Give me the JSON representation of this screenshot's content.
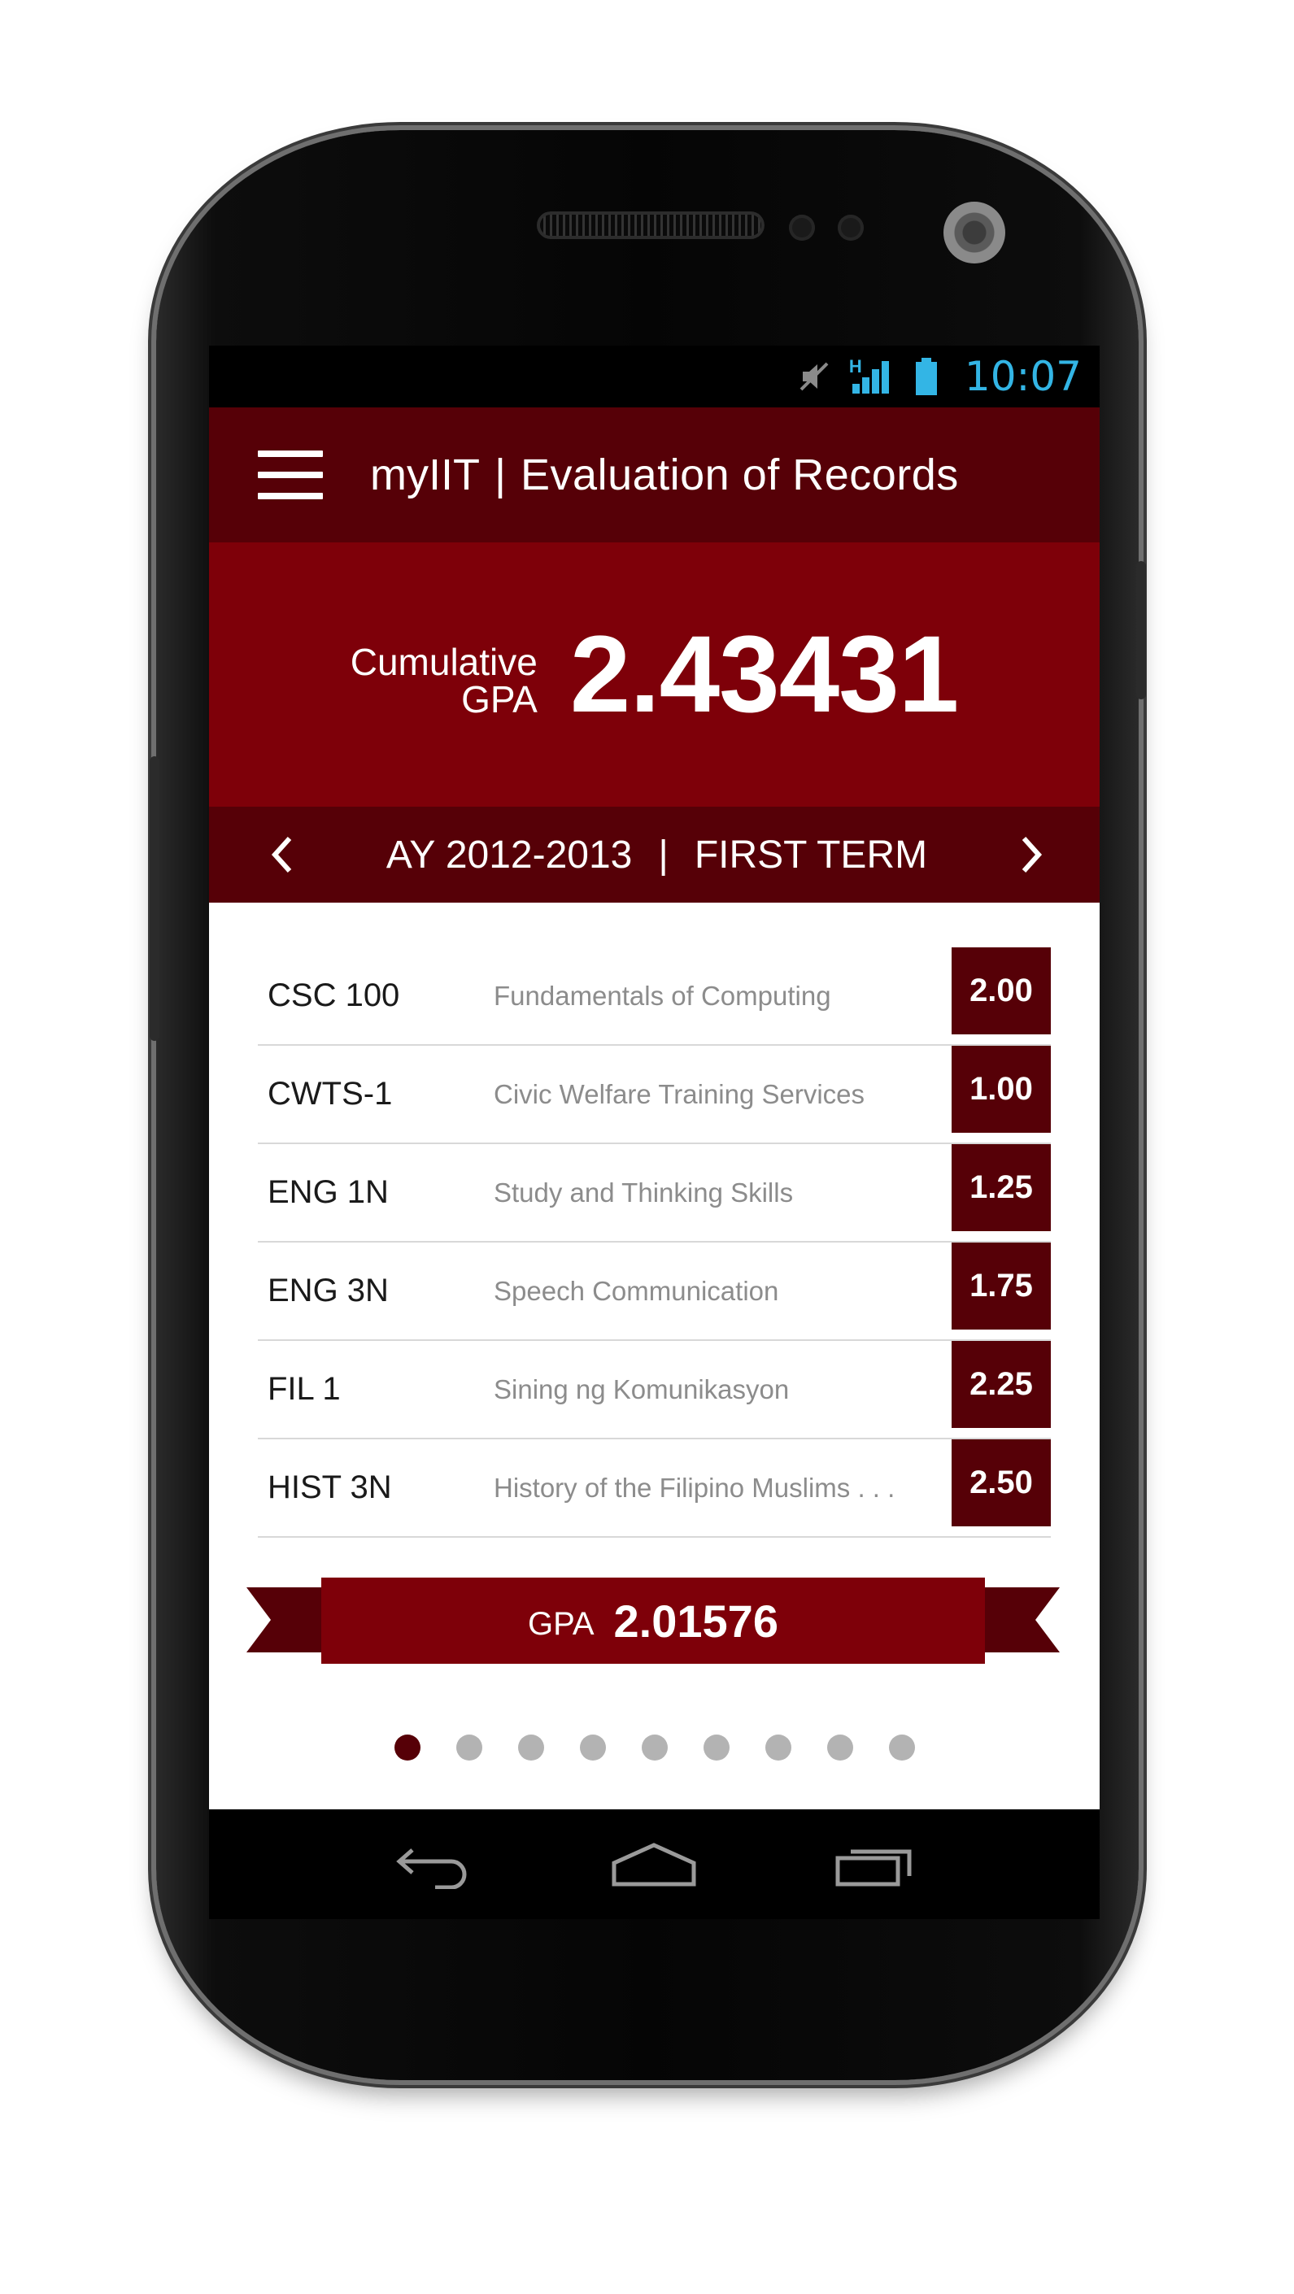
{
  "status_bar": {
    "time": "10:07",
    "network_type": "H",
    "icons": [
      "mute-icon",
      "signal-icon",
      "battery-icon"
    ],
    "accent_color": "#33b5e5"
  },
  "app_bar": {
    "app_name": "myIIT",
    "separator": "|",
    "page_title": "Evaluation of Records",
    "menu_icon": "hamburger-menu-icon"
  },
  "cumulative": {
    "label_line1": "Cumulative",
    "label_line2": "GPA",
    "value": "2.43431"
  },
  "term_nav": {
    "academic_year": "AY 2012-2013",
    "separator": "|",
    "term": "FIRST TERM",
    "prev_icon": "chevron-left-icon",
    "next_icon": "chevron-right-icon"
  },
  "courses": [
    {
      "code": "CSC  100",
      "name": "Fundamentals of Computing",
      "grade": "2.00"
    },
    {
      "code": "CWTS-1",
      "name": "Civic Welfare Training Services",
      "grade": "1.00"
    },
    {
      "code": "ENG 1N",
      "name": "Study and Thinking Skills",
      "grade": "1.25"
    },
    {
      "code": "ENG 3N",
      "name": "Speech Communication",
      "grade": "1.75"
    },
    {
      "code": "FIL 1",
      "name": "Sining ng Komunikasyon",
      "grade": "2.25"
    },
    {
      "code": "HIST 3N",
      "name": "History of the Filipino Muslims . . .",
      "grade": "2.50"
    }
  ],
  "term_gpa": {
    "label": "GPA",
    "value": "2.01576"
  },
  "pager": {
    "total_pages": 9,
    "active_page": 1
  },
  "nav_bar": {
    "icons": [
      "back-icon",
      "home-icon",
      "recent-apps-icon"
    ]
  },
  "colors": {
    "dark_maroon": "#560007",
    "maroon": "#7e0009",
    "dot_inactive": "#b3b3b3"
  }
}
